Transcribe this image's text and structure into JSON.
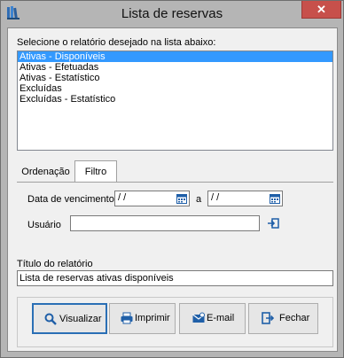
{
  "window": {
    "title": "Lista de reservas",
    "close_glyph": "✕"
  },
  "report_list": {
    "prompt": "Selecione o relatório desejado na lista abaixo:",
    "items": [
      "Ativas - Disponíveis",
      "Ativas - Efetuadas",
      "Ativas - Estatístico",
      "Excluídas",
      "Excluídas - Estatístico"
    ],
    "selected_index": 0
  },
  "tabs": {
    "ordering_label": "Ordenação",
    "filter_label": "Filtro",
    "active": "Filtro"
  },
  "filter": {
    "due_date_label": "Data de vencimento",
    "date_from_value": "/ /",
    "range_separator": "a",
    "date_to_value": "/ /",
    "user_label": "Usuário",
    "user_value": ""
  },
  "report_title": {
    "label": "Título do relatório",
    "value": "Lista de reservas ativas disponíveis"
  },
  "buttons": {
    "view_label": "Visualizar",
    "print_label": "Imprimir",
    "email_label": "E-mail",
    "close_label": "Fechar"
  },
  "icons": {
    "app": "books-icon",
    "calendar": "calendar-icon",
    "user_lookup": "user-lookup-icon",
    "view": "magnifier-icon",
    "print": "printer-icon",
    "email": "envelope-icon",
    "close": "exit-door-icon"
  },
  "colors": {
    "selection": "#3399ff",
    "close_button": "#c7504b",
    "accent_blue": "#1f5fa8"
  }
}
